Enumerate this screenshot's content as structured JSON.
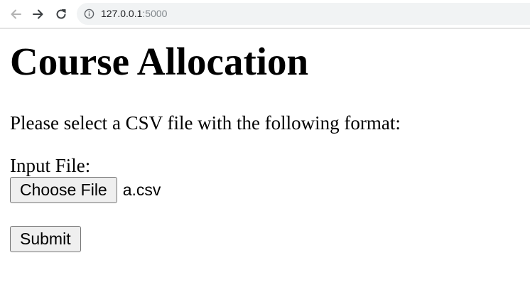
{
  "browser": {
    "url_host": "127.0.0.1",
    "url_port": ":5000",
    "icons": {
      "back": "arrow-left-icon",
      "forward": "arrow-right-icon",
      "reload": "reload-icon",
      "site_info": "info-icon"
    }
  },
  "page": {
    "title": "Course Allocation",
    "description": "Please select a CSV file with the following format:",
    "input_label": "Input File:",
    "choose_file_label": "Choose File",
    "selected_file": "a.csv",
    "submit_label": "Submit"
  }
}
